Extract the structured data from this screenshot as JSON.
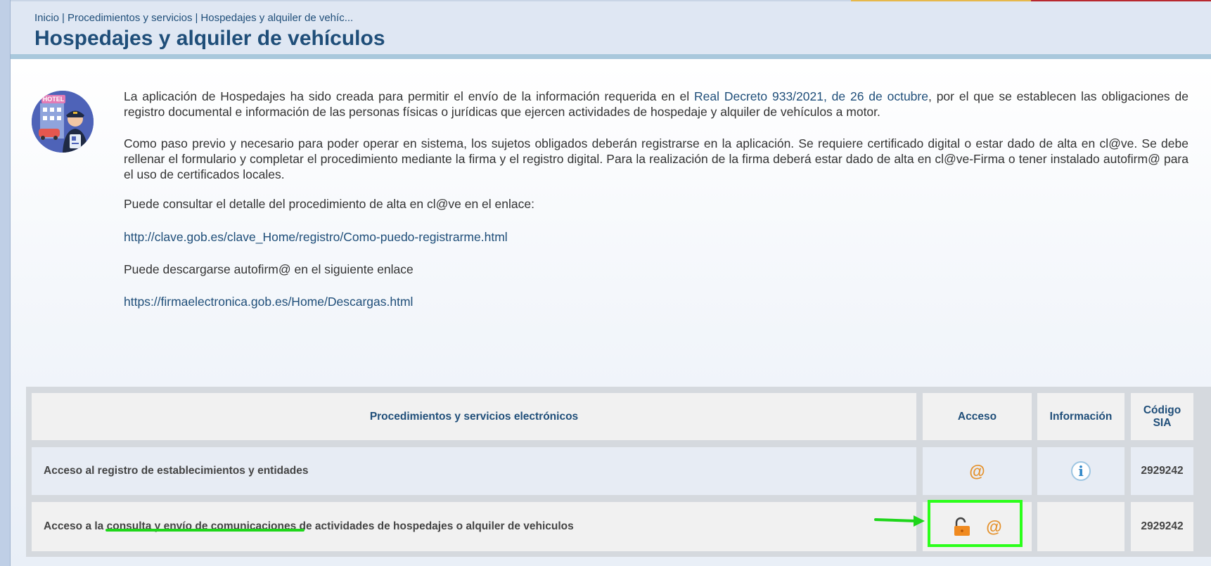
{
  "breadcrumb": {
    "items": [
      "Inicio",
      "Procedimientos y servicios",
      "Hospedajes y alquiler de vehíc..."
    ],
    "separator": "|"
  },
  "page": {
    "title": "Hospedajes y alquiler de vehículos"
  },
  "intro": {
    "p1_before": "La aplicación de Hospedajes ha sido creada para permitir el envío de la información requerida en el ",
    "p1_link": "Real Decreto 933/2021, de 26 de octubre",
    "p1_after": ", por el que se establecen las obligaciones de registro documental e información de las personas físicas o jurídicas que ejercen actividades de hospedaje y alquiler de vehículos a motor.",
    "p2": "Como paso previo y necesario para poder operar en sistema, los sujetos obligados deberán registrarse en la aplicación. Se requiere certificado digital o estar dado de alta en cl@ve. Se debe rellenar el formulario y completar el procedimiento mediante la firma y el registro digital. Para la realización de la firma deberá estar dado de alta en cl@ve-Firma o tener instalado autofirm@ para el uso de certificados locales.",
    "p3": "Puede consultar el detalle del procedimiento de alta en cl@ve en el enlace:",
    "link1": "http://clave.gob.es/clave_Home/registro/Como-puedo-registrarme.html",
    "p4": "Puede descargarse autofirm@ en el siguiente enlace",
    "link2": "https://firmaelectronica.gob.es/Home/Descargas.html"
  },
  "table": {
    "headers": {
      "procedures": "Procedimientos y servicios electrónicos",
      "access": "Acceso",
      "info": "Información",
      "sia_line1": "Código",
      "sia_line2": "SIA"
    },
    "rows": [
      {
        "name": "Acceso al registro de establecimientos y entidades",
        "access_symbol": "@",
        "info_symbol": "i",
        "sia": "2929242"
      },
      {
        "name_before": "Acceso a la ",
        "name_highlight": "consulta y envío de comunicaciones",
        "name_after": " de actividades de hospedajes o alquiler de vehiculos",
        "access_symbol": "@",
        "sia": "2929242"
      }
    ]
  },
  "icons": {
    "avatar": "hotel-receptionist-avatar-icon",
    "unlock": "unlock-icon",
    "at": "at-sign-icon",
    "info": "info-icon"
  },
  "colors": {
    "brand_blue": "#1f4e79",
    "accent_orange": "#e5922d",
    "annotation_green": "#2bff1a"
  }
}
